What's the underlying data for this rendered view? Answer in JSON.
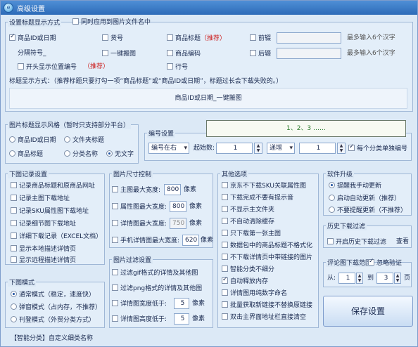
{
  "title": "高级设置",
  "g_title": {
    "legend": "设置标题显示方式",
    "apply_filename": "同时应用到图片文件名中",
    "c_product_id": "商品ID或日期",
    "c_huohao": "货号",
    "c_product_title": "商品标题",
    "c_recommend": "（推荐）",
    "c_prefix": "前辍",
    "c_max1": "最多输入6个汉字",
    "separator": "分隔符号_",
    "c_onekey": "一键搬图",
    "c_product_code": "商品编码",
    "c_suffix": "后辍",
    "c_max2": "最多输入6个汉字",
    "c_start_pos": "开头显示位置编号",
    "c_recommend2": "（推荐）",
    "c_line": "行号",
    "desc": "标题显示方式：（推荐标题只要打勾一项“商品标题”或“商品ID或日期”，标题过长会下载失败的。）",
    "preview": "商品ID或日期_一键搬图"
  },
  "g_style": {
    "legend": "图片标题显示风格（暂时只支持部分平台）",
    "r1": "商品ID或日期",
    "r2": "文件夹标题",
    "r3": "商品标题",
    "r4": "分类名称",
    "r5": "无文字"
  },
  "g_num": {
    "legend": "编号设置",
    "seq": "1、2、3 ……",
    "pos": "编号在右",
    "start_label": "起始数:",
    "start_val": "1",
    "mode": "递增",
    "step_val": "1",
    "per_class": "每个分类单独编号"
  },
  "g_dl": {
    "legend": "下图记录设置",
    "items": [
      "记录商品标题和原商品网址",
      "记录主图下载地址",
      "记录SKU属性图下载地址",
      "记录细节图下载地址",
      "详细下载记录（EXCEL文档）",
      "显示本地描述详情页",
      "显示远程描述详情页"
    ]
  },
  "g_size": {
    "legend": "图片尺寸控制",
    "rows": [
      {
        "label": "主图最大宽度:",
        "val": "800",
        "unit": "像素"
      },
      {
        "label": "属性图最大宽度:",
        "val": "800",
        "unit": "像素"
      },
      {
        "label": "详情图最大宽度:",
        "val": "750",
        "unit": "像素"
      },
      {
        "label": "手机详情图最大宽度:",
        "val": "620",
        "unit": "像素"
      }
    ]
  },
  "g_filter": {
    "legend": "图片过滤设置",
    "f1": "过滤gif格式的详情及其他图",
    "f2": "过滤png格式的详情及其他图",
    "f3": "详情图宽度低于:",
    "f3_val": "5",
    "f3_unit": "像素",
    "f4": "详情图高度低于:",
    "f4_val": "5",
    "f4_unit": "像素"
  },
  "g_other": {
    "legend": "其他选项",
    "items": [
      "京东不下载SKU关联属性图",
      "下载完成不要有提示音",
      "不显示主文件夹",
      "不自动清除缓存",
      "只下载第一张主图",
      "数据包中的商品标题不格式化",
      "不下载详情页中带链接的图片",
      "智能分类不细分",
      "自动释放内存",
      "详情图用纯数字命名",
      "批量获取新链接不替换原链接",
      "双击主界面地址栏直接清空"
    ]
  },
  "g_upgrade": {
    "legend": "软件升级",
    "r1": "提醒我手动更新",
    "r2": "启动自动更新（推荐）",
    "r3": "不要提醒更新（不推荐）"
  },
  "g_history": {
    "legend": "历史下载过滤",
    "c1": "开启历史下载过滤",
    "view": "查看"
  },
  "g_comment": {
    "legend": "评论图下载范围",
    "ignore": "忽略验证",
    "from": "从:",
    "from_val": "1",
    "to": "到",
    "to_val": "3",
    "page": "页"
  },
  "save": "保存设置",
  "g_mode": {
    "legend": "下图模式",
    "r1": "通常模式（稳定，速度快）",
    "r2": "弹窗模式（占内存，不推荐）",
    "r3": "刊登模式（外贸分类方式）"
  },
  "bottom": "【智能分类】自定义细类名称"
}
